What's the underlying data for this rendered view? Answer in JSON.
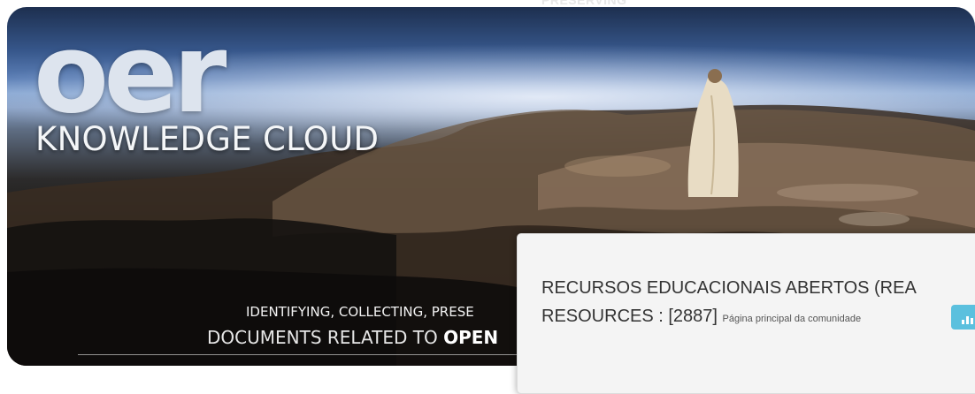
{
  "header_ghost_text": "PRESERVING",
  "banner": {
    "logo_text": "oer",
    "title": "KNOWLEDGE CLOUD",
    "tagline_line1": "IDENTIFYING, COLLECTING, PRESE",
    "tagline_line2_prefix": "DOCUMENTS RELATED TO ",
    "tagline_line2_bold": "OPEN"
  },
  "community": {
    "title": "RECURSOS EDUCACIONAIS ABERTOS (REA",
    "subtitle": "RESOURCES : [2887]",
    "home_link": "Página principal da comunidade",
    "stats_icon": "bar-chart-icon",
    "button_color": "#5bc0de"
  }
}
